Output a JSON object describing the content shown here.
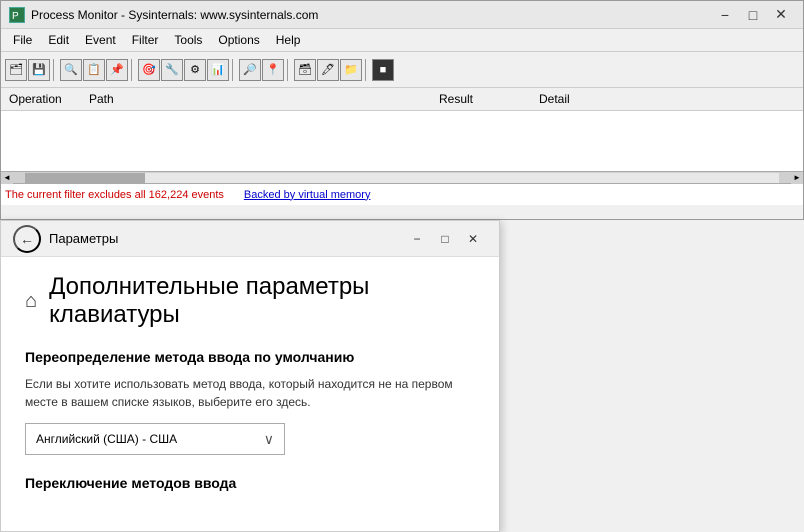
{
  "titlebar": {
    "icon": "PM",
    "title": "Process Monitor - Sysinternals: www.sysinternals.com",
    "min_btn": "−",
    "max_btn": "□",
    "close_btn": "✕"
  },
  "menubar": {
    "items": [
      "File",
      "Edit",
      "Event",
      "Filter",
      "Tools",
      "Options",
      "Help"
    ]
  },
  "columns": {
    "operation": "Operation",
    "path": "Path",
    "result": "Result",
    "detail": "Detail"
  },
  "statusbar": {
    "filter_text": "The current filter excludes all 162,224 events",
    "memory_text": "Backed by virtual memory"
  },
  "settings": {
    "titlebar": {
      "back_label": "←",
      "title": "Параметры",
      "min_btn": "−",
      "max_btn": "□",
      "close_btn": "✕"
    },
    "page_title": "Дополнительные параметры клавиатуры",
    "section1_title": "Переопределение метода ввода по умолчанию",
    "section1_desc": "Если вы хотите использовать метод ввода, который находится не на первом месте в вашем списке языков, выберите его здесь.",
    "dropdown_value": "Английский (США) - США",
    "dropdown_arrow": "∨",
    "section2_title": "Переключение методов ввода"
  }
}
